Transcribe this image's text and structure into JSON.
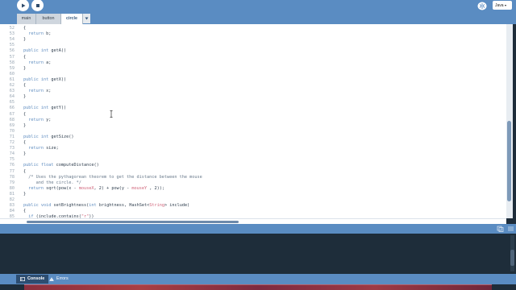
{
  "toolbar": {
    "run_icon": "play-icon",
    "stop_icon": "stop-icon",
    "mode_icon": "butterfly-icon",
    "mode_label": "Java"
  },
  "tabs": [
    {
      "label": "main",
      "active": false
    },
    {
      "label": "button",
      "active": false
    },
    {
      "label": "circle",
      "active": true
    }
  ],
  "editor": {
    "lines": [
      {
        "n": "52",
        "text": "{"
      },
      {
        "n": "53",
        "text": "  return b;"
      },
      {
        "n": "54",
        "text": "}"
      },
      {
        "n": "55",
        "text": ""
      },
      {
        "n": "56",
        "text": "public int getA()"
      },
      {
        "n": "57",
        "text": "{"
      },
      {
        "n": "58",
        "text": "  return a;"
      },
      {
        "n": "59",
        "text": "}"
      },
      {
        "n": "60",
        "text": ""
      },
      {
        "n": "61",
        "text": "public int getX()"
      },
      {
        "n": "62",
        "text": "{"
      },
      {
        "n": "63",
        "text": "  return x;"
      },
      {
        "n": "64",
        "text": "}"
      },
      {
        "n": "65",
        "text": ""
      },
      {
        "n": "66",
        "text": "public int getY()"
      },
      {
        "n": "67",
        "text": "{"
      },
      {
        "n": "68",
        "text": "  return y;"
      },
      {
        "n": "69",
        "text": "}"
      },
      {
        "n": "70",
        "text": ""
      },
      {
        "n": "71",
        "text": "public int getSize()"
      },
      {
        "n": "72",
        "text": "{"
      },
      {
        "n": "73",
        "text": "  return size;"
      },
      {
        "n": "74",
        "text": "}"
      },
      {
        "n": "75",
        "text": ""
      },
      {
        "n": "76",
        "text": "public float computeDistance()"
      },
      {
        "n": "77",
        "text": "{"
      },
      {
        "n": "78",
        "text": "  /* Uses the pythagorean theorem to get the distance between the mouse"
      },
      {
        "n": "79",
        "text": "     and the circle. */"
      },
      {
        "n": "80",
        "text": "  return sqrt(pow(x - mouseX, 2) + pow(y - mouseY , 2));"
      },
      {
        "n": "81",
        "text": "}"
      },
      {
        "n": "82",
        "text": ""
      },
      {
        "n": "83",
        "text": "public void setBrightness(int brightness, HashSet<String> include)"
      },
      {
        "n": "84",
        "text": "{"
      },
      {
        "n": "85",
        "text": "  if (include.contains(\"r\"))"
      }
    ]
  },
  "bottom_tabs": [
    {
      "label": "Console",
      "icon": "console-icon",
      "active": true
    },
    {
      "label": "Errors",
      "icon": "warning-icon",
      "active": false
    }
  ],
  "colors": {
    "chrome_blue": "#5a8cc2",
    "console_bg": "#1e2d3a",
    "keyword": "#5f8dc0",
    "comment": "#6a7b8c",
    "string": "#d0647a"
  }
}
